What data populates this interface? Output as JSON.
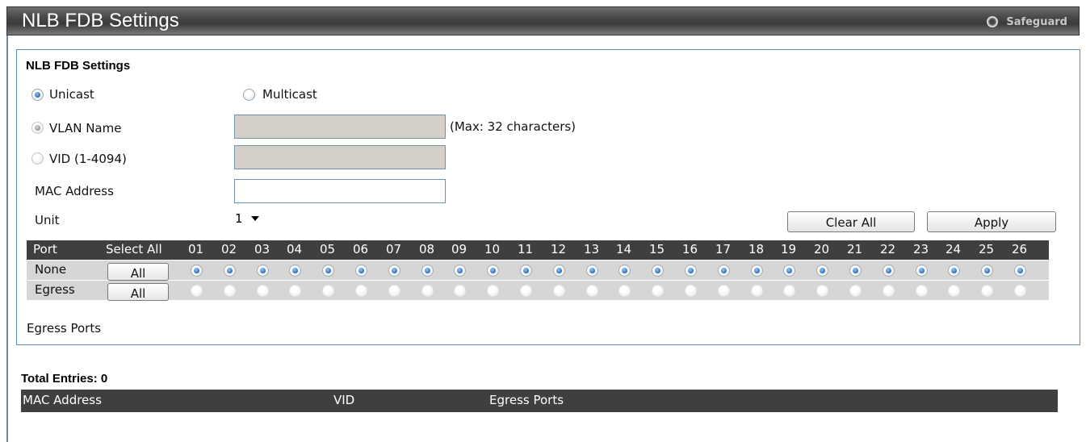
{
  "header": {
    "title": "NLB FDB Settings",
    "safeguard_label": "Safeguard"
  },
  "settings": {
    "section_title": "NLB FDB Settings",
    "unicast_label": "Unicast",
    "multicast_label": "Multicast",
    "mode_selected": "Unicast",
    "vlan_name_label": "VLAN Name",
    "vlan_name_value": "",
    "vlan_name_hint": "(Max: 32 characters)",
    "vid_label": "VID (1-4094)",
    "vid_value": "",
    "mac_label": "MAC Address",
    "mac_value": "",
    "unit_label": "Unit",
    "unit_value": "1",
    "clear_all_label": "Clear All",
    "apply_label": "Apply"
  },
  "port_table": {
    "port_header": "Port",
    "select_all_header": "Select All",
    "ports": [
      "01",
      "02",
      "03",
      "04",
      "05",
      "06",
      "07",
      "08",
      "09",
      "10",
      "11",
      "12",
      "13",
      "14",
      "15",
      "16",
      "17",
      "18",
      "19",
      "20",
      "21",
      "22",
      "23",
      "24",
      "25",
      "26"
    ],
    "rows": [
      {
        "label": "None",
        "button": "All",
        "selected": true
      },
      {
        "label": "Egress",
        "button": "All",
        "selected": false
      }
    ],
    "egress_ports_label": "Egress Ports"
  },
  "entries": {
    "total_label": "Total Entries: 0",
    "columns": [
      "MAC Address",
      "VID",
      "Egress Ports"
    ]
  },
  "colors": {
    "title_bar": "#4a4a4a",
    "panel_border": "#5b8bb3",
    "table_header": "#3f3f3f",
    "table_body": "#d6d6d6",
    "radio_selected": "#1e5ea6"
  }
}
